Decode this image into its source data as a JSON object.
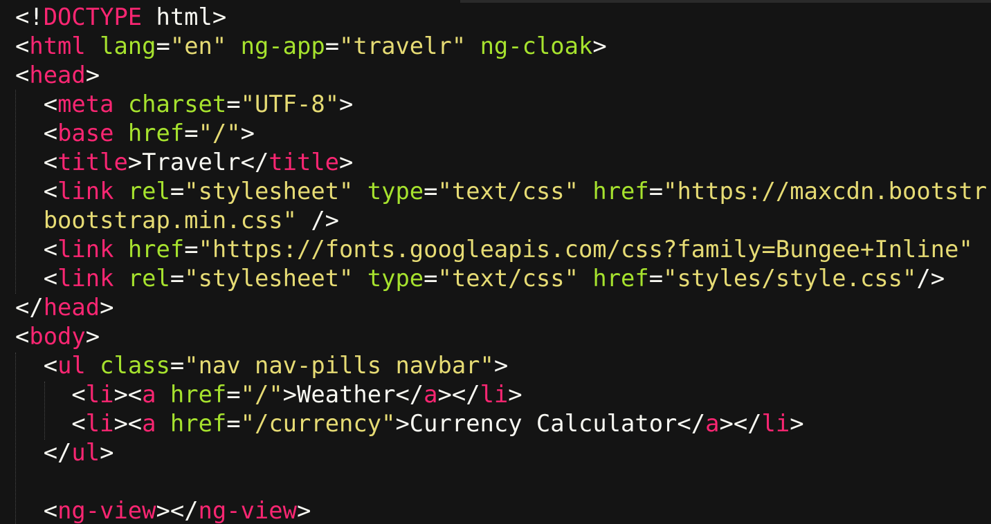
{
  "editor": {
    "theme_colors": {
      "background": "#141414",
      "text": "#f8f8f2",
      "tag": "#f92672",
      "attribute": "#a6e22e",
      "string": "#e6db74"
    },
    "lines": [
      {
        "indent": "",
        "tokens": [
          {
            "t": "<!",
            "c": "text"
          },
          {
            "t": "DOCTYPE",
            "c": "tag"
          },
          {
            "t": " html>",
            "c": "text"
          }
        ]
      },
      {
        "indent": "",
        "tokens": [
          {
            "t": "<",
            "c": "text"
          },
          {
            "t": "html",
            "c": "tag"
          },
          {
            "t": " ",
            "c": "text"
          },
          {
            "t": "lang",
            "c": "attr"
          },
          {
            "t": "=",
            "c": "text"
          },
          {
            "t": "\"en\"",
            "c": "str"
          },
          {
            "t": " ",
            "c": "text"
          },
          {
            "t": "ng-app",
            "c": "attr"
          },
          {
            "t": "=",
            "c": "text"
          },
          {
            "t": "\"travelr\"",
            "c": "str"
          },
          {
            "t": " ",
            "c": "text"
          },
          {
            "t": "ng-cloak",
            "c": "attr"
          },
          {
            "t": ">",
            "c": "text"
          }
        ]
      },
      {
        "indent": "",
        "tokens": [
          {
            "t": "<",
            "c": "text"
          },
          {
            "t": "head",
            "c": "tag"
          },
          {
            "t": ">",
            "c": "text"
          }
        ]
      },
      {
        "indent": "  ",
        "tokens": [
          {
            "t": "<",
            "c": "text"
          },
          {
            "t": "meta",
            "c": "tag"
          },
          {
            "t": " ",
            "c": "text"
          },
          {
            "t": "charset",
            "c": "attr"
          },
          {
            "t": "=",
            "c": "text"
          },
          {
            "t": "\"UTF-8\"",
            "c": "str"
          },
          {
            "t": ">",
            "c": "text"
          }
        ]
      },
      {
        "indent": "  ",
        "tokens": [
          {
            "t": "<",
            "c": "text"
          },
          {
            "t": "base",
            "c": "tag"
          },
          {
            "t": " ",
            "c": "text"
          },
          {
            "t": "href",
            "c": "attr"
          },
          {
            "t": "=",
            "c": "text"
          },
          {
            "t": "\"/\"",
            "c": "str"
          },
          {
            "t": ">",
            "c": "text"
          }
        ]
      },
      {
        "indent": "  ",
        "tokens": [
          {
            "t": "<",
            "c": "text"
          },
          {
            "t": "title",
            "c": "tag"
          },
          {
            "t": ">Travelr</",
            "c": "text"
          },
          {
            "t": "title",
            "c": "tag"
          },
          {
            "t": ">",
            "c": "text"
          }
        ]
      },
      {
        "indent": "  ",
        "tokens": [
          {
            "t": "<",
            "c": "text"
          },
          {
            "t": "link",
            "c": "tag"
          },
          {
            "t": " ",
            "c": "text"
          },
          {
            "t": "rel",
            "c": "attr"
          },
          {
            "t": "=",
            "c": "text"
          },
          {
            "t": "\"stylesheet\"",
            "c": "str"
          },
          {
            "t": " ",
            "c": "text"
          },
          {
            "t": "type",
            "c": "attr"
          },
          {
            "t": "=",
            "c": "text"
          },
          {
            "t": "\"text/css\"",
            "c": "str"
          },
          {
            "t": " ",
            "c": "text"
          },
          {
            "t": "href",
            "c": "attr"
          },
          {
            "t": "=",
            "c": "text"
          },
          {
            "t": "\"https://maxcdn.bootstr",
            "c": "str"
          }
        ]
      },
      {
        "indent": "  ",
        "tokens": [
          {
            "t": "bootstrap.min.css\"",
            "c": "str"
          },
          {
            "t": " />",
            "c": "text"
          }
        ]
      },
      {
        "indent": "  ",
        "tokens": [
          {
            "t": "<",
            "c": "text"
          },
          {
            "t": "link",
            "c": "tag"
          },
          {
            "t": " ",
            "c": "text"
          },
          {
            "t": "href",
            "c": "attr"
          },
          {
            "t": "=",
            "c": "text"
          },
          {
            "t": "\"https://fonts.googleapis.com/css?family=Bungee+Inline\"",
            "c": "str"
          }
        ]
      },
      {
        "indent": "  ",
        "tokens": [
          {
            "t": "<",
            "c": "text"
          },
          {
            "t": "link",
            "c": "tag"
          },
          {
            "t": " ",
            "c": "text"
          },
          {
            "t": "rel",
            "c": "attr"
          },
          {
            "t": "=",
            "c": "text"
          },
          {
            "t": "\"stylesheet\"",
            "c": "str"
          },
          {
            "t": " ",
            "c": "text"
          },
          {
            "t": "type",
            "c": "attr"
          },
          {
            "t": "=",
            "c": "text"
          },
          {
            "t": "\"text/css\"",
            "c": "str"
          },
          {
            "t": " ",
            "c": "text"
          },
          {
            "t": "href",
            "c": "attr"
          },
          {
            "t": "=",
            "c": "text"
          },
          {
            "t": "\"styles/style.css\"",
            "c": "str"
          },
          {
            "t": "/>",
            "c": "text"
          }
        ]
      },
      {
        "indent": "",
        "tokens": [
          {
            "t": "</",
            "c": "text"
          },
          {
            "t": "head",
            "c": "tag"
          },
          {
            "t": ">",
            "c": "text"
          }
        ]
      },
      {
        "indent": "",
        "tokens": [
          {
            "t": "<",
            "c": "text"
          },
          {
            "t": "body",
            "c": "tag"
          },
          {
            "t": ">",
            "c": "text"
          }
        ]
      },
      {
        "indent": "  ",
        "tokens": [
          {
            "t": "<",
            "c": "text"
          },
          {
            "t": "ul",
            "c": "tag"
          },
          {
            "t": " ",
            "c": "text"
          },
          {
            "t": "class",
            "c": "attr"
          },
          {
            "t": "=",
            "c": "text"
          },
          {
            "t": "\"nav nav-pills navbar\"",
            "c": "str"
          },
          {
            "t": ">",
            "c": "text"
          }
        ]
      },
      {
        "indent": "    ",
        "tokens": [
          {
            "t": "<",
            "c": "text"
          },
          {
            "t": "li",
            "c": "tag"
          },
          {
            "t": "><",
            "c": "text"
          },
          {
            "t": "a",
            "c": "tag"
          },
          {
            "t": " ",
            "c": "text"
          },
          {
            "t": "href",
            "c": "attr"
          },
          {
            "t": "=",
            "c": "text"
          },
          {
            "t": "\"/\"",
            "c": "str"
          },
          {
            "t": ">Weather</",
            "c": "text"
          },
          {
            "t": "a",
            "c": "tag"
          },
          {
            "t": "></",
            "c": "text"
          },
          {
            "t": "li",
            "c": "tag"
          },
          {
            "t": ">",
            "c": "text"
          }
        ]
      },
      {
        "indent": "    ",
        "tokens": [
          {
            "t": "<",
            "c": "text"
          },
          {
            "t": "li",
            "c": "tag"
          },
          {
            "t": "><",
            "c": "text"
          },
          {
            "t": "a",
            "c": "tag"
          },
          {
            "t": " ",
            "c": "text"
          },
          {
            "t": "href",
            "c": "attr"
          },
          {
            "t": "=",
            "c": "text"
          },
          {
            "t": "\"/currency\"",
            "c": "str"
          },
          {
            "t": ">Currency Calculator</",
            "c": "text"
          },
          {
            "t": "a",
            "c": "tag"
          },
          {
            "t": "></",
            "c": "text"
          },
          {
            "t": "li",
            "c": "tag"
          },
          {
            "t": ">",
            "c": "text"
          }
        ]
      },
      {
        "indent": "  ",
        "tokens": [
          {
            "t": "</",
            "c": "text"
          },
          {
            "t": "ul",
            "c": "tag"
          },
          {
            "t": ">",
            "c": "text"
          }
        ]
      },
      {
        "indent": "",
        "tokens": []
      },
      {
        "indent": "  ",
        "tokens": [
          {
            "t": "<",
            "c": "text"
          },
          {
            "t": "ng-view",
            "c": "tag"
          },
          {
            "t": "></",
            "c": "text"
          },
          {
            "t": "ng-view",
            "c": "tag"
          },
          {
            "t": ">",
            "c": "text"
          }
        ]
      }
    ]
  }
}
